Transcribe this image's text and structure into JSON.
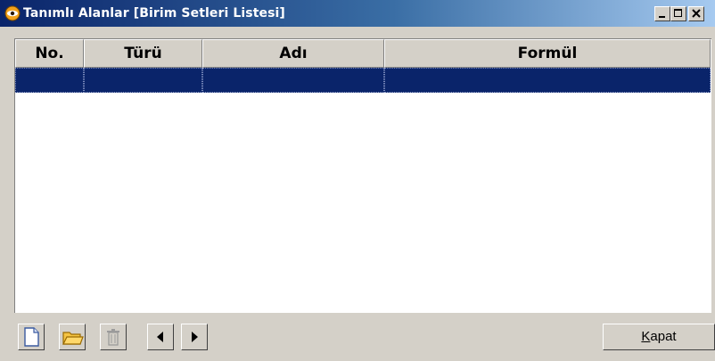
{
  "window": {
    "title": "Tanımlı Alanlar [Birim Setleri Listesi]",
    "controls": {
      "minimize_icon": "minimize-icon",
      "maximize_icon": "maximize-icon",
      "close_icon": "close-icon"
    }
  },
  "table": {
    "columns": [
      "No.",
      "Türü",
      "Adı",
      "Formül"
    ],
    "rows": [
      [
        "",
        "",
        "",
        ""
      ]
    ],
    "selected_row": 0,
    "colors": {
      "selection": "#0a246a"
    }
  },
  "toolbar": {
    "buttons": [
      {
        "icon": "new-document-icon",
        "enabled": true
      },
      {
        "icon": "open-folder-icon",
        "enabled": true
      },
      {
        "icon": "trash-icon",
        "enabled": false
      },
      {
        "icon": "arrow-left-icon",
        "enabled": true
      },
      {
        "icon": "arrow-right-icon",
        "enabled": true
      }
    ],
    "close_label_access_key": "K",
    "close_label_rest": "apat"
  }
}
